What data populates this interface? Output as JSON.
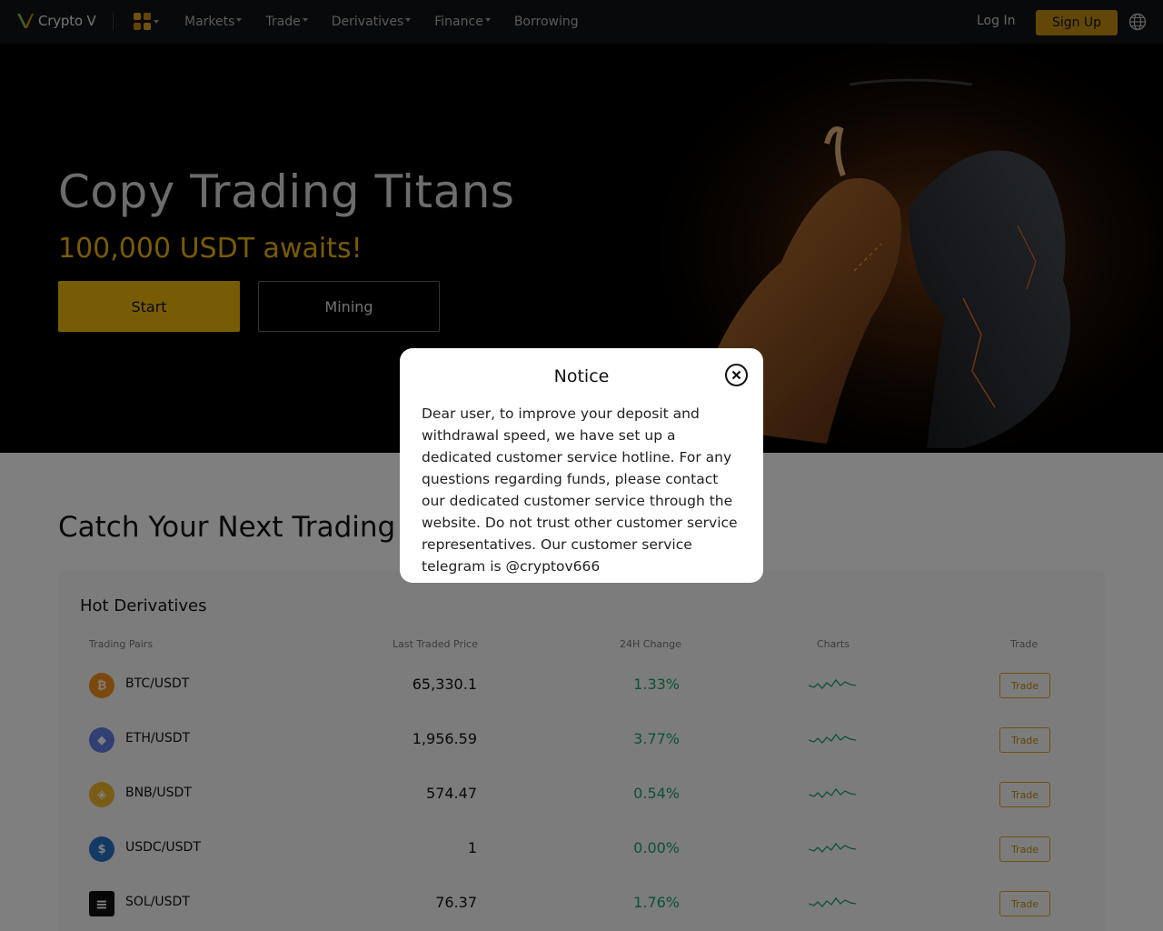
{
  "nav": {
    "logo_text": "Crypto V",
    "menu": [
      {
        "label": "Markets",
        "has_caret": true
      },
      {
        "label": "Trade",
        "has_caret": true
      },
      {
        "label": "Derivatives",
        "has_caret": true
      },
      {
        "label": "Finance",
        "has_caret": true
      },
      {
        "label": "Borrowing",
        "has_caret": false
      }
    ],
    "login_label": "Log In",
    "signup_label": "Sign Up",
    "icons": {
      "apps": "apps-grid-icon",
      "language": "globe-icon"
    }
  },
  "hero": {
    "title": "Copy Trading Titans",
    "subtitle": "100,000 USDT awaits!",
    "start_label": "Start",
    "mining_label": "Mining"
  },
  "section": {
    "title": "Catch Your Next Trading Opportunity",
    "card_title": "Hot Derivatives",
    "columns": {
      "pairs": "Trading Pairs",
      "price": "Last Traded Price",
      "change": "24H Change",
      "charts": "Charts",
      "trade": "Trade"
    },
    "rows": [
      {
        "pair": "BTC/USDT",
        "price": "65,330.1",
        "change": "1.33%",
        "trade": "Trade",
        "icon": "bitcoin-icon"
      },
      {
        "pair": "ETH/USDT",
        "price": "1,956.59",
        "change": "3.77%",
        "trade": "Trade",
        "icon": "ethereum-icon"
      },
      {
        "pair": "BNB/USDT",
        "price": "574.47",
        "change": "0.54%",
        "trade": "Trade",
        "icon": "bnb-icon"
      },
      {
        "pair": "USDC/USDT",
        "price": "1",
        "change": "0.00%",
        "trade": "Trade",
        "icon": "usdc-icon"
      },
      {
        "pair": "SOL/USDT",
        "price": "76.37",
        "change": "1.76%",
        "trade": "Trade",
        "icon": "solana-icon"
      }
    ]
  },
  "modal": {
    "title": "Notice",
    "body": "Dear user, to improve your deposit and withdrawal speed, we have set up a dedicated customer service hotline. For any questions regarding funds, please contact our dedicated customer service through the website. Do not trust other customer service representatives. Our customer service telegram is @cryptov666"
  },
  "colors": {
    "accent": "#f0b90b",
    "positive": "#1aa26b",
    "nav_bg": "#111214"
  }
}
